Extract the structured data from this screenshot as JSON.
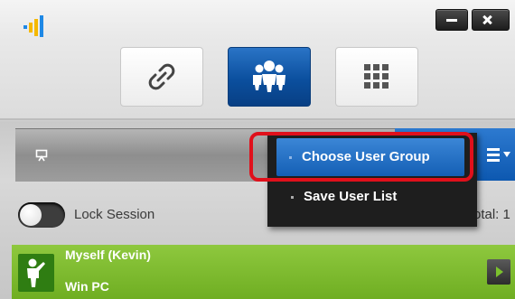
{
  "window": {
    "logo_icon": "signal-bars-logo-icon",
    "minimize_icon": "minimize-icon",
    "close_icon": "close-icon"
  },
  "modes": [
    {
      "id": "link",
      "icon": "link-icon",
      "active": false
    },
    {
      "id": "users",
      "icon": "users-group-icon",
      "active": true
    },
    {
      "id": "grid",
      "icon": "grid-icon",
      "active": false
    }
  ],
  "toolbar": {
    "left_icon": "presentation-icon",
    "list_icon": "list-menu-icon"
  },
  "menu": {
    "items": [
      {
        "label": "Choose User Group",
        "highlighted": true
      },
      {
        "label": "Save User List",
        "highlighted": false
      }
    ]
  },
  "lock": {
    "label": "Lock Session",
    "enabled": false
  },
  "total": {
    "label": "otal: 1"
  },
  "users": [
    {
      "name": "Myself (Kevin)",
      "device": "Win PC",
      "avatar_icon": "presenter-icon",
      "action_icon": "play-icon"
    }
  ],
  "colors": {
    "accent_blue": "#0b4f9e",
    "user_row_green": "#7dbb2e",
    "highlight_red": "#e0101b"
  }
}
